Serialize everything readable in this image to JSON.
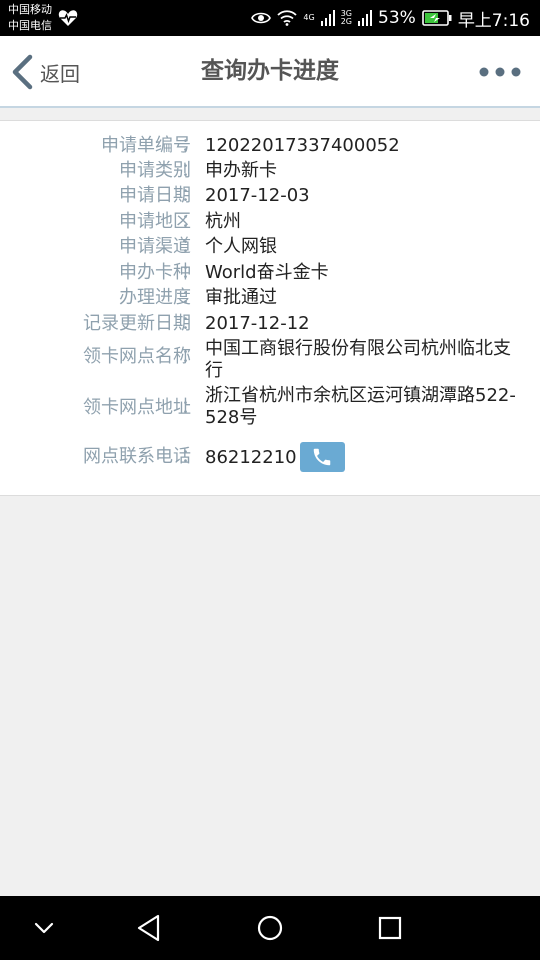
{
  "status_bar": {
    "carrier_1": "中国移动",
    "carrier_2": "中国电信",
    "network_1": "4G",
    "network_2": "3G",
    "network_3": "2G",
    "battery": "53%",
    "time": "早上7:16",
    "icons": [
      "heart-rate-icon",
      "eye-icon",
      "wifi-icon",
      "signal-icon",
      "battery-charging-icon"
    ]
  },
  "header": {
    "back_label": "返回",
    "title": "查询办卡进度",
    "icons": [
      "chevron-left-icon",
      "more-dots-icon"
    ]
  },
  "details": [
    {
      "label": "申请单编号",
      "colon": "：",
      "value": "12022017337400052"
    },
    {
      "label": "申请类别",
      "colon": "：",
      "value": "申办新卡"
    },
    {
      "label": "申请日期",
      "colon": "：",
      "value": "2017-12-03"
    },
    {
      "label": "申请地区",
      "colon": "：",
      "value": "杭州"
    },
    {
      "label": "申请渠道",
      "colon": "：",
      "value": "个人网银"
    },
    {
      "label": "申办卡种",
      "colon": "：",
      "value": "World奋斗金卡"
    },
    {
      "label": "办理进度",
      "colon": "：",
      "value": "审批通过"
    },
    {
      "label": "记录更新日期",
      "colon": "：",
      "value": "2017-12-12"
    },
    {
      "label": "领卡网点名称",
      "colon": "：",
      "value": "中国工商银行股份有限公司杭州临北支行"
    },
    {
      "label": "领卡网点地址",
      "colon": "：",
      "value": "浙江省杭州市余杭区运河镇湖潭路522-528号"
    },
    {
      "label": "网点联系电话",
      "colon": "：",
      "value": "86212210"
    }
  ],
  "nav_bar": {
    "icons": [
      "collapse-icon",
      "back-triangle-icon",
      "home-circle-icon",
      "recents-square-icon"
    ]
  },
  "colors": {
    "label": "#8fa1ae",
    "value": "#222222",
    "call_button": "#6aaad3",
    "background": "#f0f0f0"
  }
}
